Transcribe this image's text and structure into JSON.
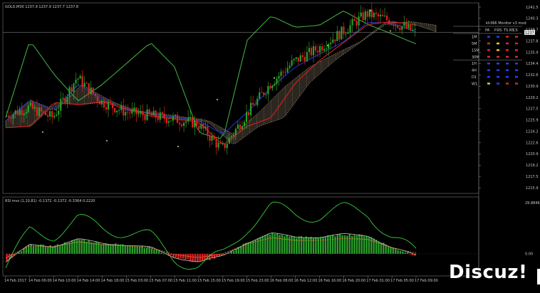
{
  "main_panel": {
    "title": "GOLD,M30 1237.9 1237.9 1237.7 1237.8",
    "price_ticks": [
      "1241.5",
      "1240.3",
      "1238.7",
      "1237.8",
      "1235.9",
      "1234.4",
      "1232.6",
      "1230.9",
      "1229.2",
      "1227.5",
      "1225.9",
      "1224.2",
      "1222.6",
      "1220.9",
      "1219.2",
      "1217.5",
      "1215.9"
    ],
    "current_price": "1237.8"
  },
  "mtf_table": {
    "title": "kh366 Monitor v3 mod",
    "columns": [
      "PA",
      "P.RS",
      "TS.RS",
      "CS"
    ],
    "rows": [
      {
        "tf": "1M",
        "cells": [
          "blue",
          "blue",
          "red",
          "red"
        ]
      },
      {
        "tf": "5M",
        "cells": [
          "red",
          "yellow",
          "red",
          "red"
        ]
      },
      {
        "tf": "15M",
        "cells": [
          "red",
          "yellow",
          "red",
          "red"
        ]
      },
      {
        "tf": "30M",
        "cells": [
          "red",
          "red",
          "red",
          "red"
        ]
      },
      {
        "tf": "1H",
        "cells": [
          "blue",
          "blue",
          "blue",
          "blue"
        ]
      },
      {
        "tf": "4H",
        "cells": [
          "blue",
          "blue",
          "blue",
          "blue"
        ]
      },
      {
        "tf": "D1",
        "cells": [
          "blue",
          "blue",
          "blue",
          "blue"
        ]
      },
      {
        "tf": "W1",
        "cells": [
          "yellow",
          "blue",
          "red",
          "red"
        ]
      }
    ]
  },
  "sub_panel": {
    "title": "RSI mvs (1,10,81) -0.1372 -0.1372 -0.3364 0.2220",
    "ticks": [
      "29.8846",
      "0.00"
    ]
  },
  "time_axis": [
    "14 Feb 2017",
    "14 Feb 06:00",
    "14 Feb 10:00",
    "14 Feb 14:00",
    "14 Feb 18:00",
    "15 Feb 03:00",
    "15 Feb 07:00",
    "15 Feb 11:00",
    "15 Feb 15:00",
    "15 Feb 19:00",
    "15 Feb 23:00",
    "16 Feb 08:00",
    "16 Feb 12:00",
    "16 Feb 16:00",
    "16 Feb 20:00",
    "17 Feb 01:00",
    "17 Feb 05:00",
    "17 Feb 09:00"
  ],
  "watermark": "Discuz!",
  "colors": {
    "background": "#000000",
    "bull": "#2aa02a",
    "bear": "#e02020",
    "kijun": "#1a33c8",
    "tenkan": "#d81e1e",
    "chikou": "#3ea83e",
    "cloud": "#f0d8b0",
    "grid": "#3a3a3a"
  },
  "chart_data": [
    {
      "type": "line",
      "title": "GOLD,M30",
      "xlabel": "",
      "ylabel": "",
      "ylim": [
        1215.9,
        1241.5
      ],
      "x": [
        "14 Feb 2017",
        "14 Feb 06:00",
        "14 Feb 10:00",
        "14 Feb 14:00",
        "14 Feb 18:00",
        "15 Feb 03:00",
        "15 Feb 07:00",
        "15 Feb 11:00",
        "15 Feb 15:00",
        "15 Feb 19:00",
        "15 Feb 23:00",
        "16 Feb 08:00",
        "16 Feb 12:00",
        "16 Feb 16:00",
        "16 Feb 20:00",
        "17 Feb 01:00",
        "17 Feb 05:00",
        "17 Feb 09:00"
      ],
      "series": [
        {
          "values": [
            1226.2,
            1227.4,
            1226.0,
            1231.6,
            1228.2,
            1226.8,
            1226.3,
            1225.8,
            1225.2,
            1221.6,
            1226.4,
            1230.7,
            1233.8,
            1235.6,
            1237.9,
            1240.4,
            1239.4,
            1237.8
          ]
        },
        {
          "values": [
            1225.6,
            1228.4,
            1227.0,
            1230.6,
            1228.6,
            1227.0,
            1226.6,
            1226.1,
            1225.6,
            1223.7,
            1226.7,
            1230.2,
            1233.0,
            1234.8,
            1236.5,
            1239.2,
            1239.1,
            1237.9
          ]
        },
        {
          "values": [
            1224.6,
            1224.8,
            1228.1,
            1227.8,
            1228.2,
            1227.2,
            1226.2,
            1225.8,
            1225.4,
            1222.2,
            1224.8,
            1226.0,
            1230.8,
            1233.9,
            1236.4,
            1238.9,
            1239.3,
            1238.8
          ]
        },
        {
          "values": [
            1226.0,
            1236.7,
            1232.0,
            1228.3,
            1230.6,
            1233.5,
            1236.4,
            1233.0,
            1223.9,
            1223.0,
            1236.7,
            1240.1,
            1238.5,
            1238.8,
            1240.8,
            1238.9,
            1237.6,
            1236.2
          ]
        }
      ]
    },
    {
      "type": "bar",
      "title": "RSI mvs (1,10,81)",
      "ylim": [
        -10.8,
        29.8846
      ],
      "x": [
        "14 Feb 2017",
        "14 Feb 06:00",
        "14 Feb 10:00",
        "14 Feb 14:00",
        "14 Feb 18:00",
        "15 Feb 03:00",
        "15 Feb 07:00",
        "15 Feb 11:00",
        "15 Feb 15:00",
        "15 Feb 19:00",
        "15 Feb 23:00",
        "16 Feb 08:00",
        "16 Feb 12:00",
        "16 Feb 16:00",
        "16 Feb 20:00",
        "17 Feb 01:00",
        "17 Feb 05:00",
        "17 Feb 09:00"
      ],
      "values": [
        -4.7,
        5.0,
        4.3,
        8.2,
        5.9,
        5.0,
        3.5,
        -2.0,
        -4.5,
        -1.3,
        6.4,
        11.5,
        9.4,
        9.4,
        10.9,
        10.2,
        3.5,
        -0.9
      ]
    }
  ]
}
